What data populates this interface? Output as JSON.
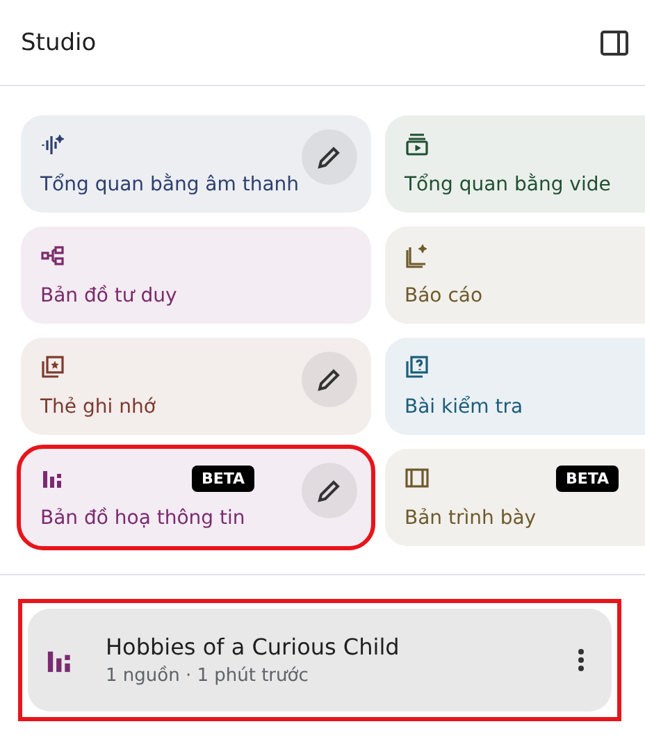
{
  "header": {
    "title": "Studio"
  },
  "tiles": [
    {
      "kind": "audio",
      "label": "Tổng quan bằng âm thanh",
      "color": "#2e3f6e",
      "editable": true,
      "highlighted": false
    },
    {
      "kind": "video",
      "label": "Tổng quan bằng vide",
      "color": "#1f5130",
      "editable": false,
      "highlighted": false
    },
    {
      "kind": "mindmap",
      "label": "Bản đồ tư duy",
      "color": "#7b2a6c",
      "editable": false,
      "highlighted": false
    },
    {
      "kind": "report",
      "label": "Báo cáo",
      "color": "#6e5a2c",
      "editable": false,
      "highlighted": false
    },
    {
      "kind": "flashcards",
      "label": "Thẻ ghi nhớ",
      "color": "#7d3a2c",
      "editable": true,
      "highlighted": false
    },
    {
      "kind": "quiz",
      "label": "Bài kiểm tra",
      "color": "#1b5d7c",
      "editable": false,
      "highlighted": false
    },
    {
      "kind": "infographic",
      "label": "Bản đồ hoạ thông tin",
      "color": "#7b2a72",
      "editable": true,
      "badge": "BETA",
      "highlighted": true
    },
    {
      "kind": "slides",
      "label": "Bản trình bày",
      "color": "#6e5a2c",
      "editable": false,
      "badge": "BETA",
      "highlighted": false
    }
  ],
  "artifacts": [
    {
      "title": "Hobbies of a Curious Child",
      "meta": "1 nguồn · 1 phút trước",
      "highlighted": true
    }
  ]
}
